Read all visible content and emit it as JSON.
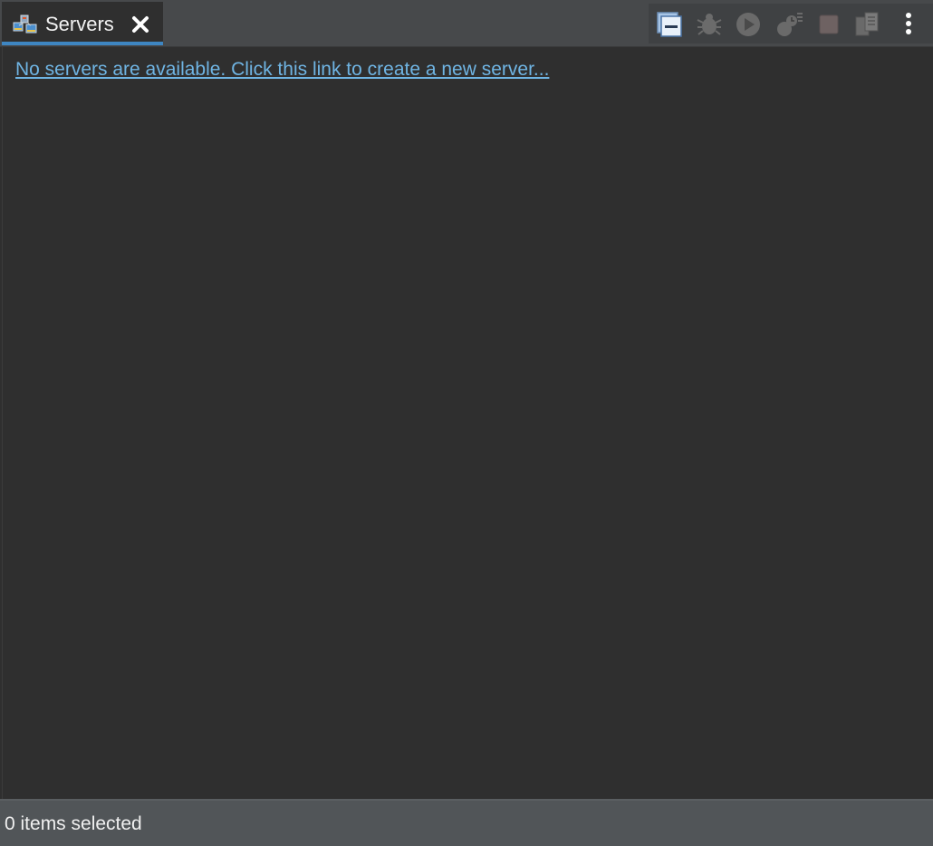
{
  "tab": {
    "label": "Servers",
    "icon": "servers-view-icon",
    "close_icon": "close-icon",
    "active_indicator_color": "#3e86c2"
  },
  "toolbar": {
    "items": [
      {
        "name": "collapse-all-icon",
        "enabled": true
      },
      {
        "name": "debug-server-icon",
        "enabled": false
      },
      {
        "name": "start-server-icon",
        "enabled": false
      },
      {
        "name": "profile-server-icon",
        "enabled": false
      },
      {
        "name": "stop-server-icon",
        "enabled": false
      },
      {
        "name": "publish-server-icon",
        "enabled": false
      },
      {
        "name": "view-menu-icon",
        "enabled": true
      }
    ]
  },
  "content": {
    "create_link": "No servers are available. Click this link to create a new server...",
    "link_color": "#6fb4e3"
  },
  "status": {
    "text": "0 items selected"
  }
}
